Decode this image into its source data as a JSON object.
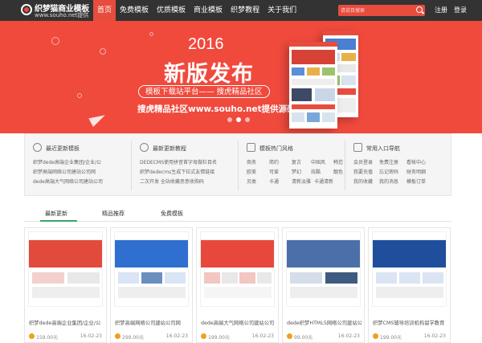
{
  "logo": {
    "title": "织梦猫商业模板",
    "subtitle": "www.souho.net提供"
  },
  "nav": [
    "首页",
    "免费模板",
    "优质模板",
    "商业模板",
    "织梦教程",
    "关于我们"
  ],
  "search": {
    "placeholder": "请说目搜索"
  },
  "auth": {
    "register": "注册",
    "login": "登录"
  },
  "banner": {
    "year": "2016",
    "headline": "新版发布",
    "pill": "模板下载站平台—— 搜虎精品社区",
    "tagline": "搜虎精品社区www.souho.net提供源码",
    "active_slide": 1,
    "slides": 3
  },
  "quick": {
    "latest": {
      "title": "最近更新模板",
      "items": [
        "织梦dede高端企业集团/企业/公",
        "织梦高端网络公司建站公司网",
        "dede高端大气网络公司建站公司"
      ]
    },
    "tutorials": {
      "title": "最新更新教程",
      "items": [
        "DEDECMS使用拼音首字母做栏目名",
        "织梦dedecms生成下拉式友情链接",
        "二次开发 全站收藏恶意收购码"
      ]
    },
    "styles": {
      "title": "模板热门风格",
      "items": [
        "商务",
        "简约",
        "复古",
        "中国风",
        "韩范",
        "欧美",
        "可爱",
        "梦幻",
        "炫酷",
        "靓色",
        "另类",
        "卡通",
        "清新淡雅",
        "卡通清新",
        ""
      ]
    },
    "shortcuts": {
      "title": "常用入口导航",
      "items": [
        "会员登录",
        "免费注册",
        "看帐中心",
        "我要充值",
        "忘记密码",
        "财务明细",
        "我的收藏",
        "我的消息",
        "模板订单"
      ]
    }
  },
  "tabs": [
    "最新更新",
    "精品推荐",
    "免费模板"
  ],
  "colors": {
    "brand": "#e84c3d",
    "nav_bg": "#333333",
    "tab_accent": "#3aa56a"
  },
  "cards": [
    {
      "title": "织梦dede高端企业集团/企业/公",
      "price": "159.00元",
      "date": "16-02-23"
    },
    {
      "title": "织梦高端网络公司建站公司网",
      "price": "299.00元",
      "date": "16-02-23"
    },
    {
      "title": "dede高端大气网络公司建站公司",
      "price": "199.00元",
      "date": "16-02-23"
    },
    {
      "title": "dede织梦HTML5网络公司建站公",
      "price": "99.00元",
      "date": "16-02-23"
    },
    {
      "title": "织梦CMS辅导培训机构留学教育",
      "price": "199.00元",
      "date": "16-02-23"
    }
  ]
}
